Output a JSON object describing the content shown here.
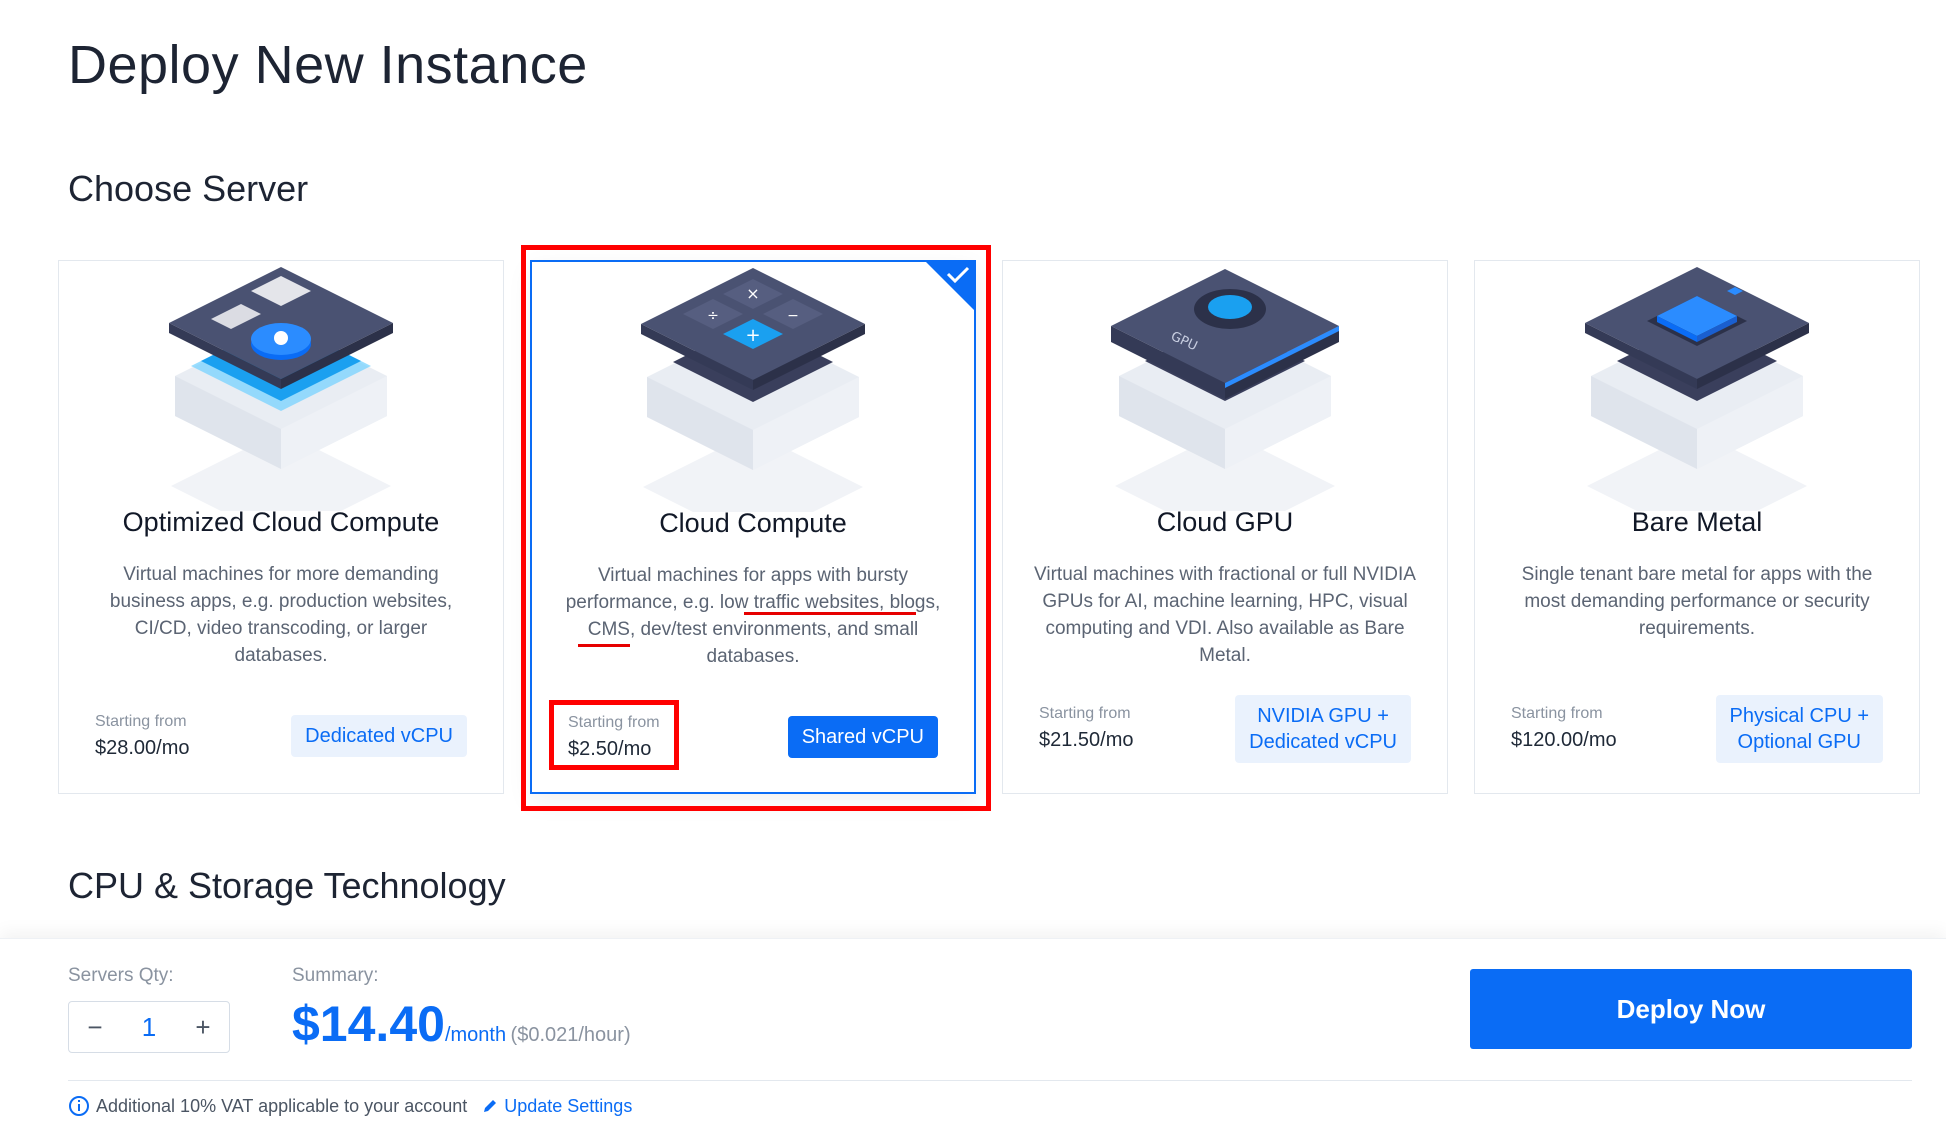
{
  "page": {
    "title": "Deploy New Instance",
    "choose_server": "Choose Server",
    "cpu_storage": "CPU & Storage Technology"
  },
  "cards": [
    {
      "name": "Optimized Cloud Compute",
      "desc": "Virtual machines for more demanding business apps, e.g. production websites, CI/CD, video transcoding, or larger databases.",
      "price_label": "Starting from",
      "price": "$28.00/mo",
      "badge": "Dedicated vCPU",
      "selected": false
    },
    {
      "name": "Cloud Compute",
      "desc_parts": [
        "Virtual machines for apps with bursty performance, e.g. ",
        "low traffic websites",
        ", ",
        "blogs",
        ", CMS, dev/test environments, and small databases."
      ],
      "price_label": "Starting from",
      "price": "$2.50/mo",
      "badge": "Shared vCPU",
      "selected": true
    },
    {
      "name": "Cloud GPU",
      "desc": "Virtual machines with fractional or full NVIDIA GPUs for AI, machine learning, HPC, visual computing and VDI. Also available as Bare Metal.",
      "price_label": "Starting from",
      "price": "$21.50/mo",
      "badge_lines": [
        "NVIDIA GPU +",
        "Dedicated vCPU"
      ],
      "selected": false
    },
    {
      "name": "Bare Metal",
      "desc": "Single tenant bare metal for apps with the most demanding performance or security requirements.",
      "price_label": "Starting from",
      "price": "$120.00/mo",
      "badge_lines": [
        "Physical CPU +",
        "Optional GPU"
      ],
      "selected": false
    }
  ],
  "gpu_chip_text": "GPU",
  "footer": {
    "qty_label": "Servers Qty:",
    "qty_minus": "−",
    "qty_value": "1",
    "qty_plus": "+",
    "summary_label": "Summary:",
    "price": "$14.40",
    "per_month": "/month",
    "per_hour": "($0.021/hour)",
    "deploy_label": "Deploy Now",
    "vat_text": "Additional 10% VAT applicable to your account",
    "update_settings": "Update Settings"
  },
  "colors": {
    "accent": "#0a6cf5",
    "annotation": "#ff0000"
  }
}
